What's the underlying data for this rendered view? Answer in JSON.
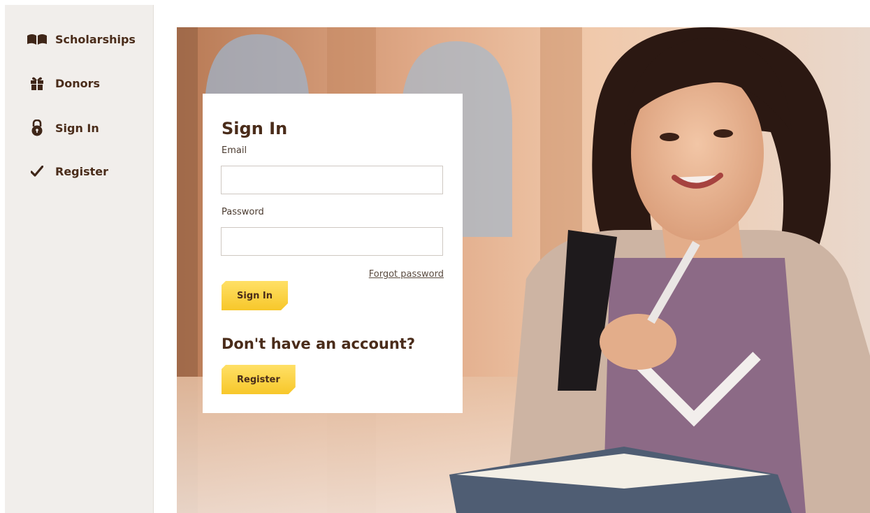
{
  "sidebar": {
    "items": [
      {
        "label": "Scholarships",
        "icon": "open-book-icon"
      },
      {
        "label": "Donors",
        "icon": "gift-icon"
      },
      {
        "label": "Sign In",
        "icon": "lock-icon"
      },
      {
        "label": "Register",
        "icon": "checkmark-icon"
      }
    ]
  },
  "signin": {
    "title": "Sign In",
    "email_label": "Email",
    "email_value": "",
    "password_label": "Password",
    "password_value": "",
    "forgot_link": "Forgot password",
    "submit_label": "Sign In",
    "no_account_heading": "Don't have an account?",
    "register_label": "Register"
  },
  "colors": {
    "sidebar_bg": "#f1eeeb",
    "text_brown": "#4a2c1a",
    "button_yellow": "#fcd94a"
  }
}
